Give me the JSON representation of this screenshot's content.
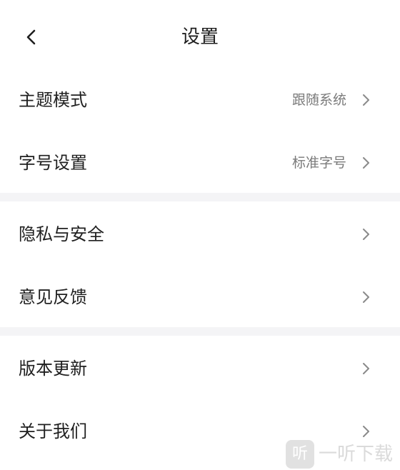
{
  "header": {
    "title": "设置",
    "back_icon": "chevron-left-icon"
  },
  "groups": [
    {
      "rows": [
        {
          "label": "主题模式",
          "value": "跟随系统",
          "icon": "chevron-right-icon"
        },
        {
          "label": "字号设置",
          "value": "标准字号",
          "icon": "chevron-right-icon"
        }
      ]
    },
    {
      "rows": [
        {
          "label": "隐私与安全",
          "value": "",
          "icon": "chevron-right-icon"
        },
        {
          "label": "意见反馈",
          "value": "",
          "icon": "chevron-right-icon"
        }
      ]
    },
    {
      "rows": [
        {
          "label": "版本更新",
          "value": "",
          "icon": "chevron-right-icon"
        },
        {
          "label": "关于我们",
          "value": "",
          "icon": "chevron-right-icon"
        }
      ]
    }
  ],
  "watermark": {
    "logo_char": "听",
    "text": "一听下载"
  },
  "colors": {
    "text_primary": "#1f1f1f",
    "text_secondary": "#7a7a7a",
    "divider": "#f4f4f6",
    "chevron": "#8a8a8a",
    "background": "#ffffff"
  }
}
